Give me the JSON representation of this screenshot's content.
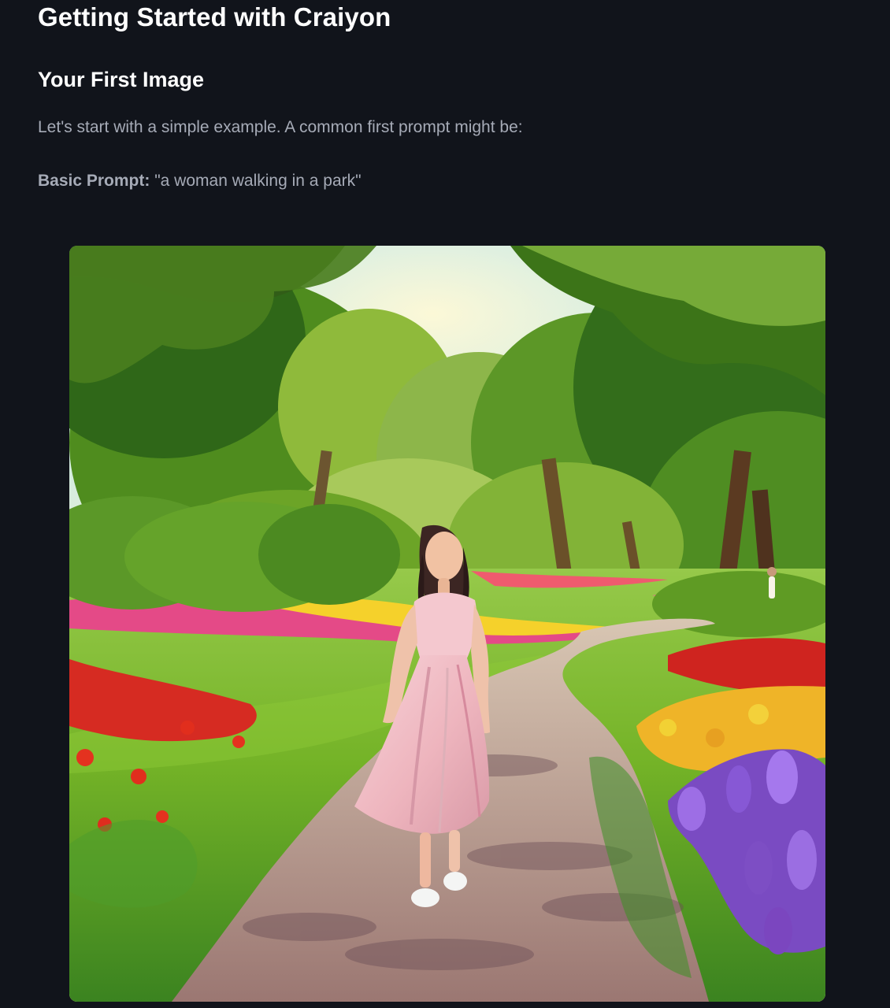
{
  "article": {
    "title": "Getting Started with Craiyon",
    "section_title": "Your First Image",
    "intro": "Let's start with a simple example. A common first prompt might be:",
    "prompt_label": "Basic Prompt:",
    "prompt_text": "\"a woman walking in a park\""
  },
  "illustration": {
    "subject": "woman-walking-park-image",
    "colors": {
      "sky": "#cfe9e7",
      "grass": "#79b52c",
      "path": "#b08f84",
      "dress": "#f2bcc4",
      "red_flowers": "#db2b24",
      "purple_flowers": "#7d4ec4",
      "yellow_flowers": "#f1cc29"
    }
  }
}
